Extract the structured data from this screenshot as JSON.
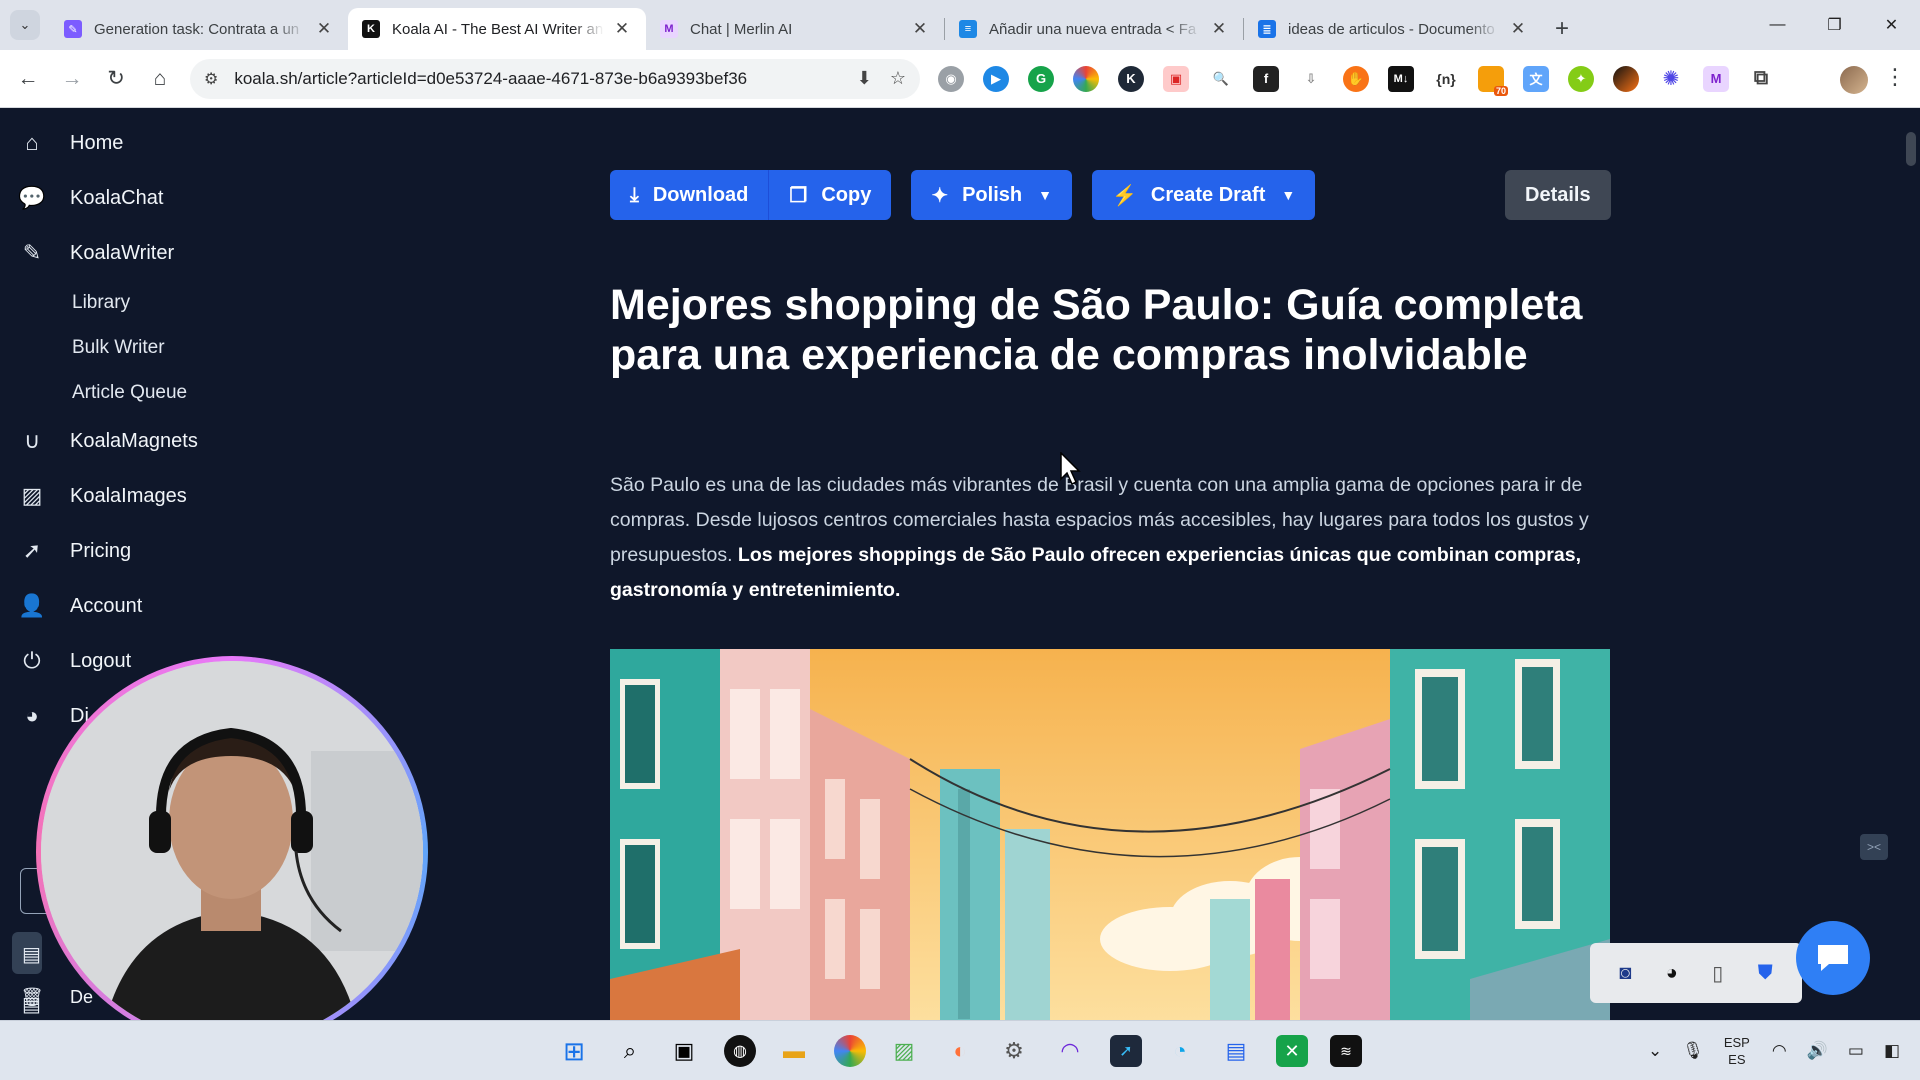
{
  "browser": {
    "tabs": [
      {
        "title": "Generation task: Contrata a un",
        "favicon_color": "#7c5cff",
        "active": false
      },
      {
        "title": "Koala AI - The Best AI Writer an",
        "favicon_color": "#111111",
        "active": true
      },
      {
        "title": "Chat | Merlin AI",
        "favicon_color": "#a855f7",
        "active": false
      },
      {
        "title": "Añadir una nueva entrada < Fa",
        "favicon_color": "#1e88e5",
        "active": false
      },
      {
        "title": "ideas de articulos - Documento",
        "favicon_color": "#1a73e8",
        "active": false
      }
    ],
    "url": "koala.sh/article?articleId=d0e53724-aaae-4671-873e-b6a9393bef36",
    "extension_badge": "70"
  },
  "sidebar": {
    "items": [
      {
        "label": "Home",
        "icon": "home-icon"
      },
      {
        "label": "KoalaChat",
        "icon": "chat-icon"
      },
      {
        "label": "KoalaWriter",
        "icon": "pencil-icon"
      },
      {
        "label": "KoalaMagnets",
        "icon": "magnet-icon"
      },
      {
        "label": "KoalaImages",
        "icon": "image-icon"
      },
      {
        "label": "Pricing",
        "icon": "rocket-icon"
      },
      {
        "label": "Account",
        "icon": "user-icon"
      },
      {
        "label": "Logout",
        "icon": "power-icon"
      },
      {
        "label": "Di",
        "icon": "discord-icon"
      }
    ],
    "subitems": [
      "Library",
      "Bulk Writer",
      "Article Queue"
    ],
    "truncated_label": "De"
  },
  "toolbar": {
    "download": "Download",
    "copy": "Copy",
    "polish": "Polish",
    "create_draft": "Create Draft",
    "details": "Details"
  },
  "article": {
    "title": "Mejores shopping de São Paulo: Guía completa para una experiencia de compras inolvidable",
    "intro_plain": "São Paulo es una de las ciudades más vibrantes de Brasil y cuenta con una amplia gama de opciones para ir de compras. Desde lujosos centros comerciales hasta espacios más accesibles, hay lugares para todos los gustos y presupuestos. ",
    "intro_bold": "Los mejores shoppings de São Paulo ofrecen experiencias únicas que combinan compras, gastronomía y entretenimiento."
  },
  "taskbar": {
    "lang_top": "ESP",
    "lang_bottom": "ES"
  },
  "colors": {
    "background": "#0f172a",
    "accent": "#2563eb",
    "details_button": "#3f4754"
  }
}
